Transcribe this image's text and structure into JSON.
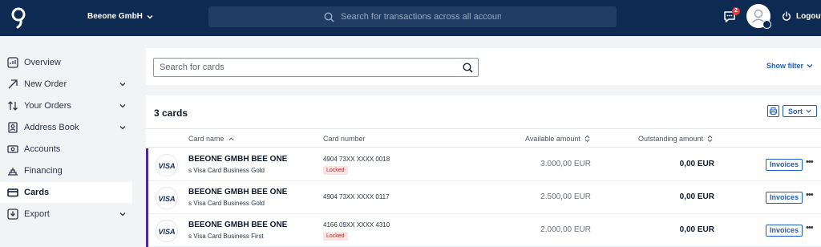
{
  "header": {
    "company": "Beeone GmbH",
    "search_placeholder": "Search for transactions across all accounts",
    "messages_badge": "2",
    "logout_label": "Logout"
  },
  "sidebar": {
    "items": [
      {
        "label": "Overview",
        "icon": "overview-icon"
      },
      {
        "label": "New Order",
        "icon": "new-order-arrow-icon",
        "expandable": true
      },
      {
        "label": "Your Orders",
        "icon": "orders-swap-icon",
        "expandable": true
      },
      {
        "label": "Address Book",
        "icon": "address-book-icon",
        "expandable": true
      },
      {
        "label": "Accounts",
        "icon": "accounts-icon"
      },
      {
        "label": "Financing",
        "icon": "financing-icon"
      },
      {
        "label": "Cards",
        "icon": "cards-icon",
        "active": true
      },
      {
        "label": "Export",
        "icon": "export-icon",
        "expandable": true
      }
    ]
  },
  "filter": {
    "search_placeholder": "Search for cards",
    "show_filter": "Show filter"
  },
  "cards": {
    "title": "3 cards",
    "sort_label": "Sort",
    "columns": {
      "name": "Card name",
      "number": "Card number",
      "available": "Available amount",
      "outstanding": "Outstanding amount"
    },
    "rows": [
      {
        "brand": "VISA",
        "name": "BEEONE GMBH BEE ONE",
        "type": "s Visa Card Business Gold",
        "number": "4904 73XX XXXX 0018",
        "status": "Locked",
        "available": "3.000,00 EUR",
        "outstanding": "0,00 EUR",
        "action": "Invoices"
      },
      {
        "brand": "VISA",
        "name": "BEEONE GMBH BEE ONE",
        "type": "s Visa Card Business Gold",
        "number": "4904 73XX XXXX 0117",
        "status": "",
        "available": "2.500,00 EUR",
        "outstanding": "0,00 EUR",
        "action": "Invoices"
      },
      {
        "brand": "VISA",
        "name": "BEEONE GMBH BEE ONE",
        "type": "s Visa Card Business First",
        "number": "4166 09XX XXXX 4310",
        "status": "Locked",
        "available": "2.000,00 EUR",
        "outstanding": "0,00 EUR",
        "action": "Invoices"
      }
    ]
  },
  "colors": {
    "header_bg": "#0d2a52",
    "accent_blue": "#1d5fbf",
    "row_accent": "#4b2aa0",
    "locked_red": "#c62828"
  }
}
